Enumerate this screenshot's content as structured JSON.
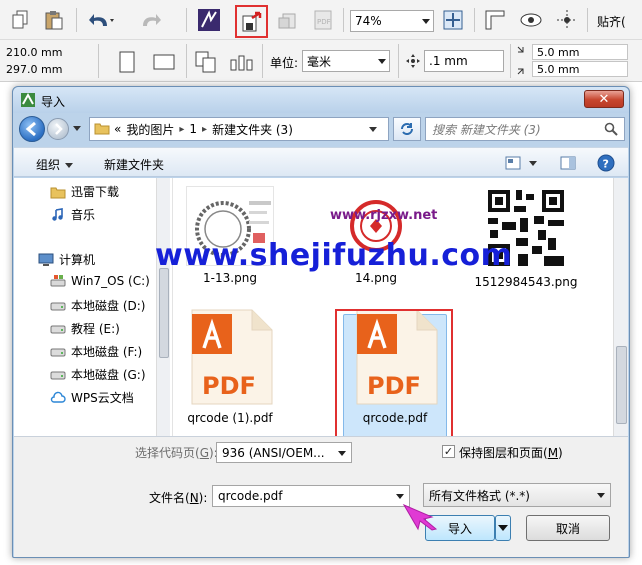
{
  "toolbar": {
    "zoom": "74%",
    "paste_label": "贴齐(",
    "width": "210.0 mm",
    "height": "297.0 mm",
    "units_label": "单位:",
    "units_value": "毫米",
    "nudge": ".1 mm",
    "dup_x": "5.0 mm",
    "dup_y": "5.0 mm",
    "highlight_color": "#e03030"
  },
  "dialog": {
    "title": "导入",
    "close_label": "✕",
    "address": {
      "prefix": "«",
      "parts": [
        "我的图片",
        "1",
        "新建文件夹 (3)"
      ]
    },
    "search_placeholder": "搜索 新建文件夹 (3)",
    "commands": {
      "organize": "组织",
      "new_folder": "新建文件夹"
    },
    "nav_items": [
      {
        "label": "迅雷下载",
        "icon": "folder-icon"
      },
      {
        "label": "音乐",
        "icon": "music-icon"
      },
      {
        "label": "计算机",
        "icon": "computer-icon"
      },
      {
        "label": "Win7_OS (C:)",
        "icon": "windows-drive-icon"
      },
      {
        "label": "本地磁盘 (D:)",
        "icon": "drive-icon"
      },
      {
        "label": "教程 (E:)",
        "icon": "drive-icon"
      },
      {
        "label": "本地磁盘 (F:)",
        "icon": "drive-icon"
      },
      {
        "label": "本地磁盘 (G:)",
        "icon": "drive-icon"
      },
      {
        "label": "WPS云文档",
        "icon": "cloud-icon"
      }
    ],
    "files": [
      {
        "name": "1-13.png",
        "kind": "seal-image"
      },
      {
        "name": "14.png",
        "kind": "seal-image"
      },
      {
        "name": "1512984543.png",
        "kind": "qr-image"
      },
      {
        "name": "qrcode (1).pdf",
        "kind": "pdf"
      },
      {
        "name": "qrcode.pdf",
        "kind": "pdf",
        "selected": true
      }
    ],
    "thumb_watermark": "www.rjzxw.net",
    "codepage": {
      "label": "选择代码页(",
      "accel": "G",
      "label_end": "):",
      "value": "936  (ANSI/OEM..."
    },
    "keep_layers": {
      "label": "保持图层和页面(",
      "accel": "M",
      "label_end": ")",
      "checked": "✓"
    },
    "filename": {
      "label": "文件名(",
      "accel": "N",
      "label_end": "):",
      "value": "qrcode.pdf"
    },
    "filetype": "所有文件格式 (*.*)",
    "import_button": "导入",
    "cancel_button": "取消"
  },
  "watermark": "www.shejifuzhu.com",
  "colors": {
    "pdf_orange": "#e8621b",
    "watermark_blue": "#1620d8",
    "arrow_magenta": "#e03ad4"
  }
}
